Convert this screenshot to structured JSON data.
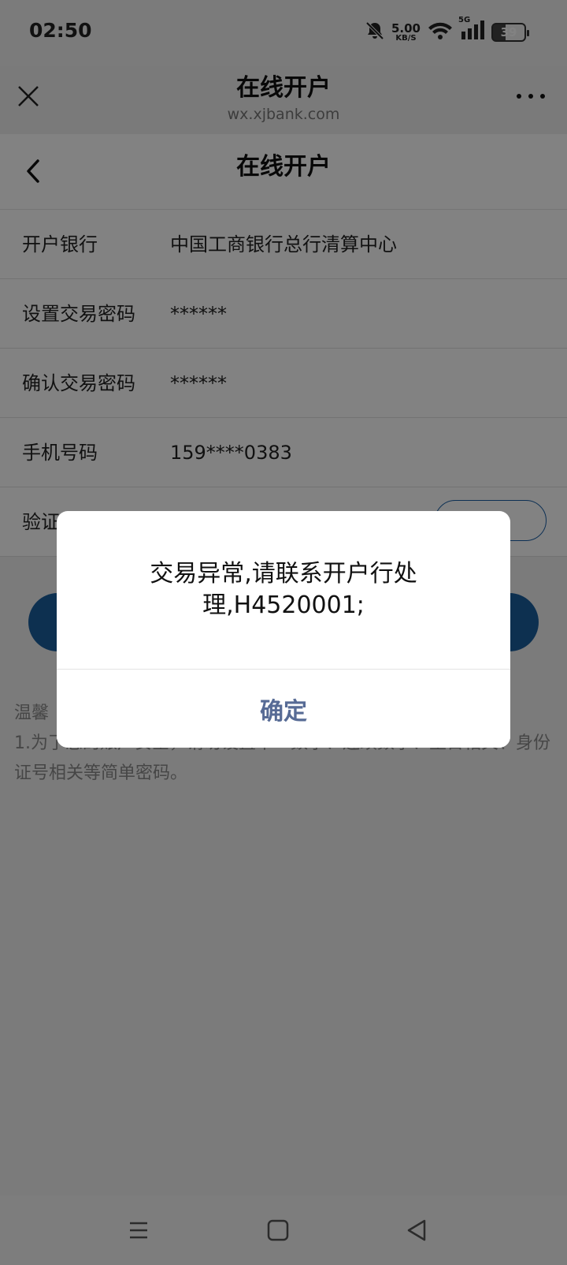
{
  "status_bar": {
    "time": "02:50",
    "net_speed_value": "5.00",
    "net_speed_unit": "KB/S",
    "network": "5G",
    "battery": "39",
    "icons": [
      "bell-muted-icon",
      "wifi-icon",
      "signal-icon",
      "battery-icon"
    ]
  },
  "webview_bar": {
    "title": "在线开户",
    "url": "wx.xjbank.com",
    "close_icon": "close-icon",
    "more_icon": "more-icon"
  },
  "page": {
    "title": "在线开户",
    "back_icon": "chevron-left-icon"
  },
  "form": {
    "rows": [
      {
        "label": "开户银行",
        "value": "中国工商银行总行清算中心"
      },
      {
        "label": "设置交易密码",
        "value": "******"
      },
      {
        "label": "确认交易密码",
        "value": "******"
      },
      {
        "label": "手机号码",
        "value": "159****0383"
      },
      {
        "label": "验证",
        "value": ""
      }
    ]
  },
  "tips": {
    "heading": "温馨",
    "body": "1.为了您的账户安全，请勿设置单一数字、连续数字、生日相关、身份证号相关等简单密码。"
  },
  "dialog": {
    "message": "交易异常,请联系开户行处理,H4520001;",
    "ok_label": "确定"
  },
  "nav_bar": {
    "icons": [
      "menu-icon",
      "home-icon",
      "back-triangle-icon"
    ]
  },
  "colors": {
    "primary": "#1b5e9e",
    "dialog_button": "#576b95",
    "overlay": "rgba(0,0,0,0.49)"
  }
}
